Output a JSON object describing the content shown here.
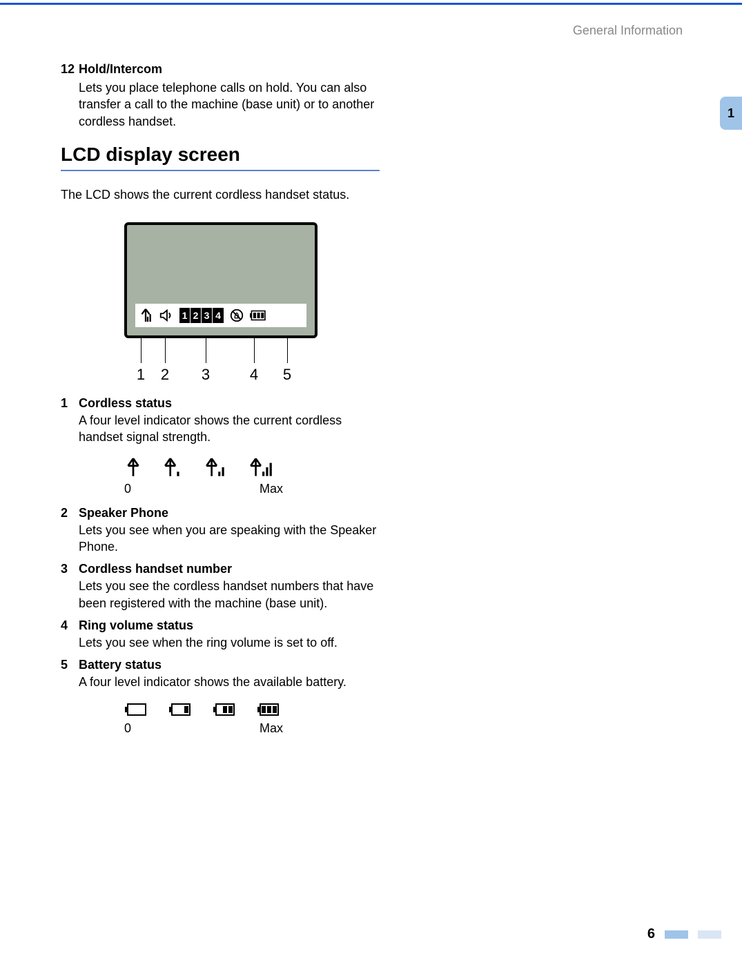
{
  "header": {
    "section": "General Information"
  },
  "tab": {
    "chapter": "1"
  },
  "item12": {
    "num": "12",
    "title": "Hold/Intercom",
    "body": "Lets you place telephone calls on hold. You can also transfer a call to the machine (base unit) or to another cordless handset."
  },
  "section_title": "LCD display screen",
  "lead": "The LCD shows the current cordless handset status.",
  "lcd": {
    "handset_numbers": [
      "1",
      "2",
      "3",
      "4"
    ],
    "callouts": [
      "1",
      "2",
      "3",
      "4",
      "5"
    ]
  },
  "legend": [
    {
      "n": "1",
      "title": "Cordless status",
      "body": "A four level indicator shows the current cordless handset signal strength."
    },
    {
      "n": "2",
      "title": "Speaker Phone",
      "body": "Lets you see when you are speaking with the Speaker Phone."
    },
    {
      "n": "3",
      "title": "Cordless handset number",
      "body": "Lets you see the cordless handset numbers that have been registered with the machine (base unit)."
    },
    {
      "n": "4",
      "title": "Ring volume status",
      "body": "Lets you see when the ring volume is set to off."
    },
    {
      "n": "5",
      "title": "Battery status",
      "body": "A four level indicator shows the available battery."
    }
  ],
  "signal_scale": {
    "min": "0",
    "max": "Max"
  },
  "battery_scale": {
    "min": "0",
    "max": "Max"
  },
  "footer": {
    "page": "6"
  }
}
